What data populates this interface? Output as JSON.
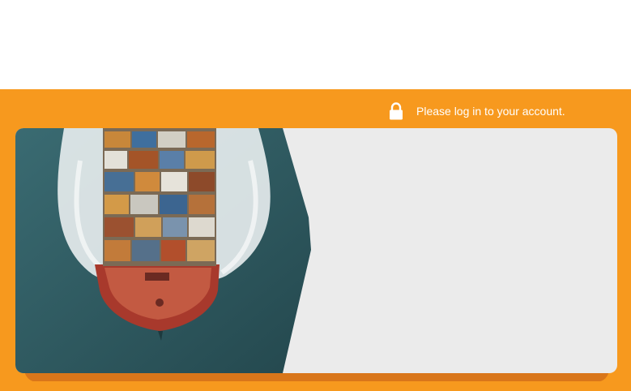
{
  "header": {
    "login_prompt": "Please log in to your account.",
    "lock_icon": "lock-icon"
  },
  "colors": {
    "band": "#f7991e",
    "panel": "#ebebeb",
    "sea": "#2f5a60",
    "hull": "#a8392c"
  },
  "hero": {
    "image": "container-ship-aerial"
  }
}
